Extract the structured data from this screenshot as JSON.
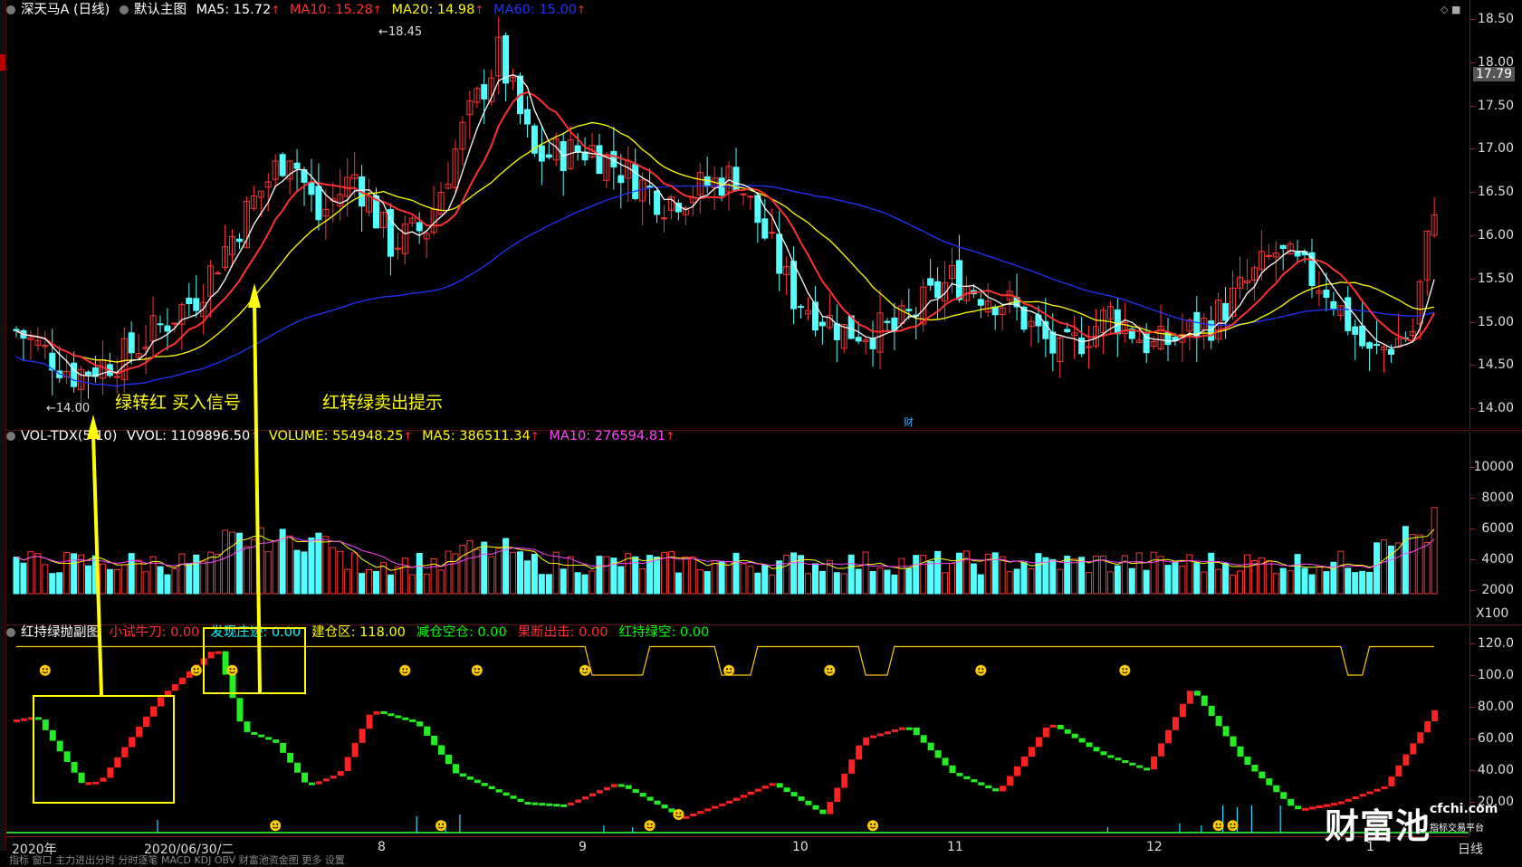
{
  "main_header": {
    "stock_name": "深天马A (日线)",
    "template": "默认主图",
    "ma5": {
      "label": "MA5: 15.72",
      "color": "#ffffff"
    },
    "ma10": {
      "label": "MA10: 15.28",
      "color": "#ff3030"
    },
    "ma20": {
      "label": "MA20: 14.98",
      "color": "#ffff00"
    },
    "ma60": {
      "label": "MA60: 15.00",
      "color": "#2233ff"
    },
    "arrow": "↑"
  },
  "main_panel": {
    "y_ticks": [
      "18.50",
      "18.00",
      "17.50",
      "17.00",
      "16.50",
      "16.00",
      "15.50",
      "15.00",
      "14.50",
      "14.00"
    ],
    "current_price": "17.79",
    "high_label": "←18.45",
    "low_label": "←14.00",
    "marker_cai": "财"
  },
  "vol_header": {
    "name": "VOL-TDX(5,10)",
    "vvol": "VVOL: 1109896.50",
    "volume": "VOLUME: 554948.25",
    "ma5": "MA5: 386511.34",
    "ma10": "MA10: 276594.81",
    "arrow": "↑"
  },
  "vol_panel": {
    "y_ticks": [
      "10000",
      "8000",
      "6000",
      "4000",
      "2000"
    ],
    "unit": "X100"
  },
  "ind_header": {
    "name": "红持绿抛副图",
    "items": [
      {
        "label": "小试牛刀: 0.00",
        "color": "#ff3030"
      },
      {
        "label": "发现庄迹: 0.00",
        "color": "#00ffff"
      },
      {
        "label": "建仓区: 118.00",
        "color": "#ffff00"
      },
      {
        "label": "减仓空仓: 0.00",
        "color": "#00ff00"
      },
      {
        "label": "果断出击: 0.00",
        "color": "#ff3030"
      },
      {
        "label": "红持绿空: 0.00",
        "color": "#00ff00"
      }
    ]
  },
  "ind_panel": {
    "y_ticks": [
      "120.0",
      "100.0",
      "80.00",
      "60.00",
      "40.00",
      "20.00"
    ]
  },
  "x_axis": {
    "labels": [
      "2020年",
      "2020/06/30/二",
      "8",
      "9",
      "10",
      "11",
      "12",
      "1"
    ],
    "period": "日线"
  },
  "annotations": {
    "buy": "绿转红 买入信号",
    "sell": "红转绿卖出提示"
  },
  "bottom_tabs": "指标 窗口 主力进出分时 分时逐笔 MACD KDJ OBV 财富池资金图 更多 设置",
  "logo": {
    "name": "财富池",
    "site": "cfchi.com",
    "sub": "指标交易平台"
  },
  "colors": {
    "up": "#ff3333",
    "down": "#54ffff",
    "bg": "#000000",
    "grid": "#5a1010"
  }
}
